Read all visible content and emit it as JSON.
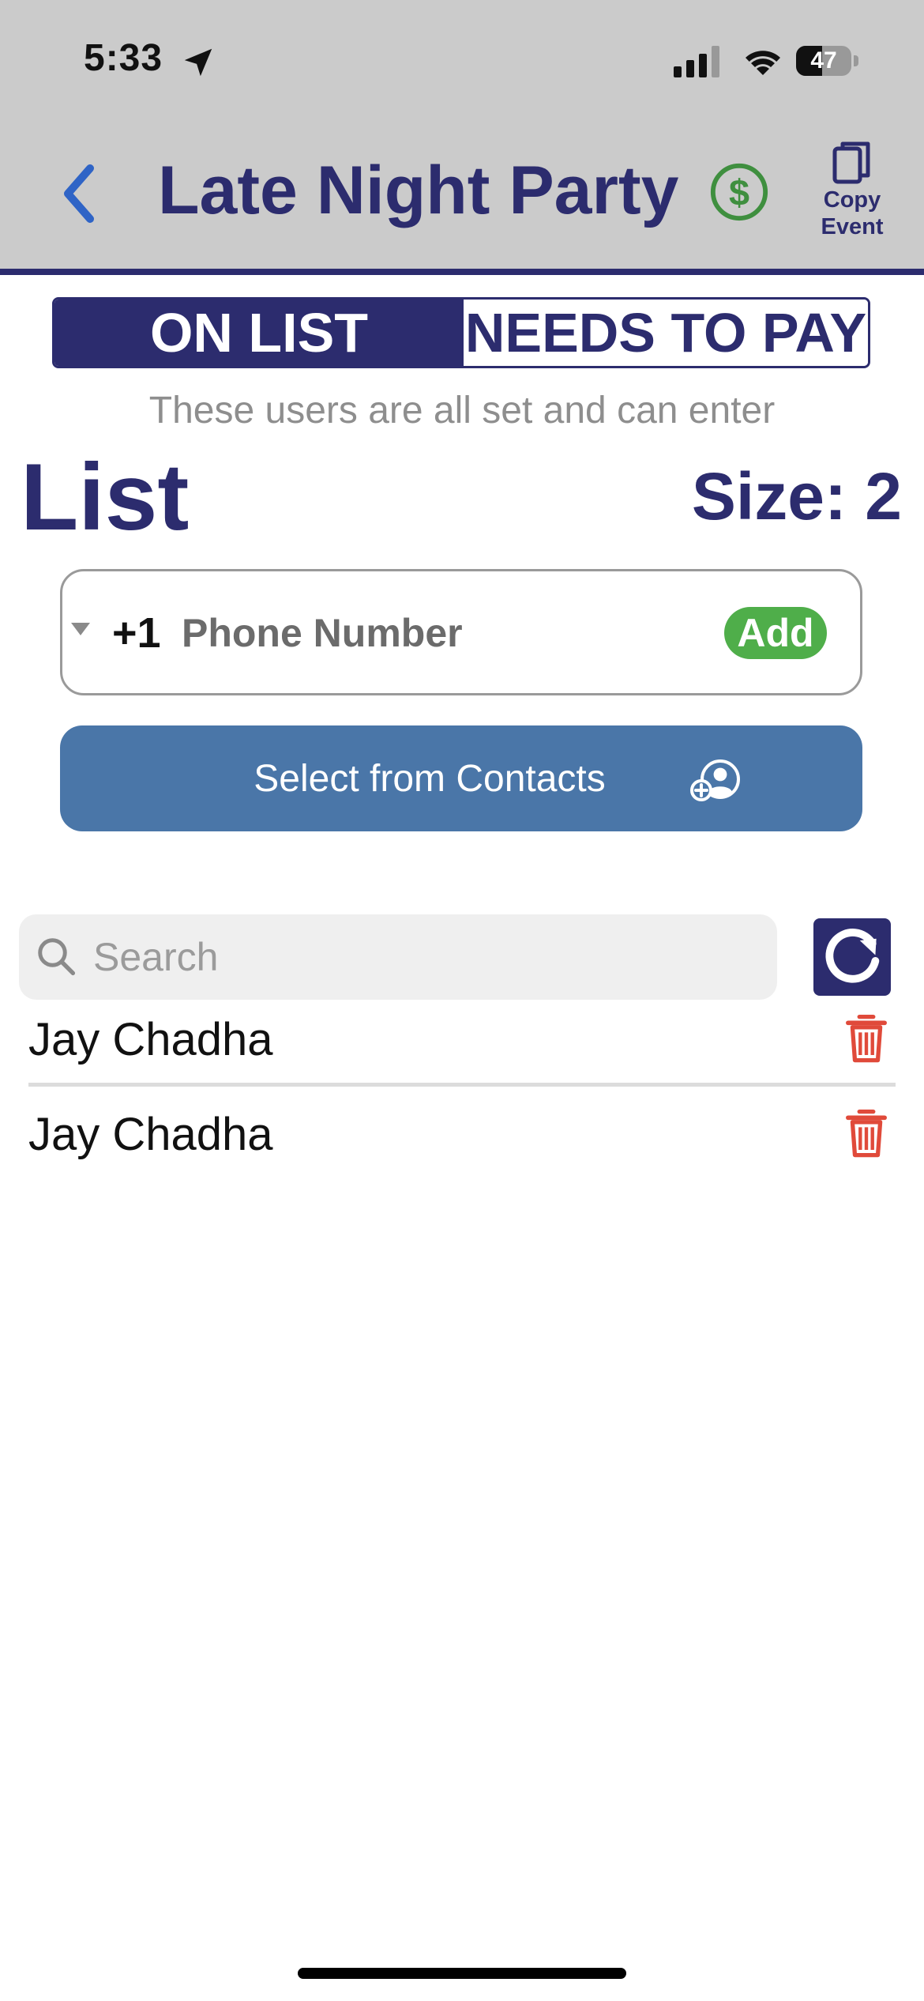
{
  "status_bar": {
    "time": "5:33",
    "battery": "47",
    "battery_level": 0.47,
    "icons": [
      "location-arrow-icon",
      "signal-icon",
      "wifi-icon",
      "battery-icon"
    ]
  },
  "header": {
    "title": "Late Night Party",
    "copy_label_line1": "Copy",
    "copy_label_line2": "Event",
    "icons": [
      "chevron-left-icon",
      "dollar-icon",
      "copy-icon"
    ]
  },
  "segment": {
    "on_list": "ON LIST",
    "needs_to_pay": "NEEDS TO PAY"
  },
  "subtitle": "These users are all set and can enter",
  "list": {
    "heading": "List",
    "size": "Size: 2"
  },
  "phone": {
    "country_code": "+1",
    "placeholder": "Phone Number",
    "value": "",
    "add_label": "Add"
  },
  "contacts": {
    "label": "Select from Contacts",
    "icon": "add-contact-icon"
  },
  "search": {
    "placeholder": "Search",
    "value": ""
  },
  "rows": [
    {
      "name": "Jay Chadha"
    },
    {
      "name": "Jay Chadha"
    }
  ],
  "colors": {
    "primary": "#2c2c6e",
    "header_bg": "#cbcbcb",
    "back_blue": "#2f64c6",
    "dollar_green": "#3f8f3f",
    "add_green": "#4fae4a",
    "contacts_blue": "#4a76a8",
    "trash_red": "#e04a3a",
    "subtitle_gray": "#8e8e8e"
  }
}
